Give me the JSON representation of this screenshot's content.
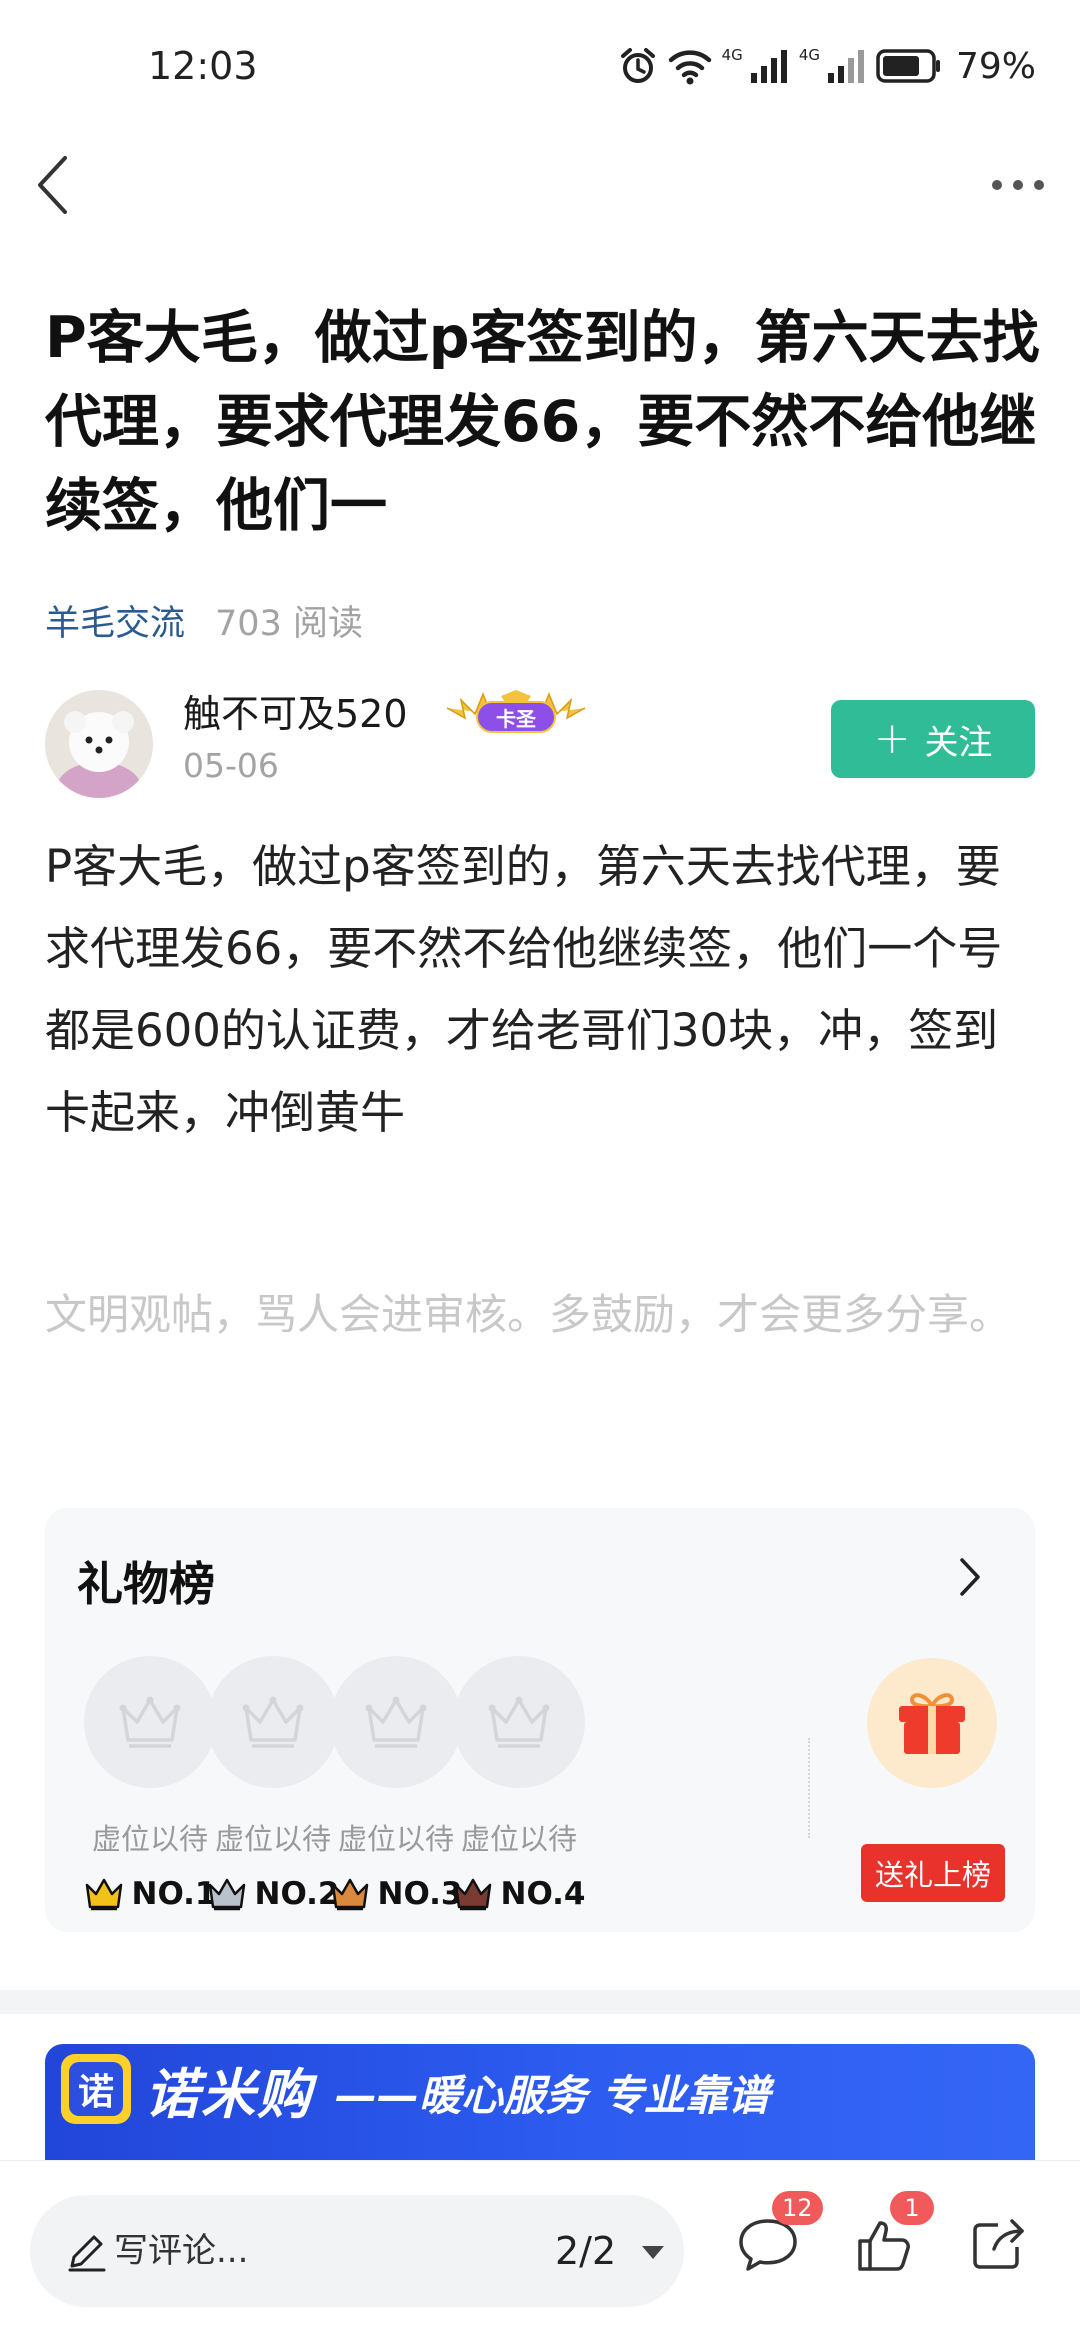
{
  "status_bar": {
    "time": "12:03",
    "network_1": "4G",
    "network_2": "4G",
    "battery": "79%",
    "battery_level": 0.79
  },
  "post": {
    "title": "P客大毛，做过p客签到的，第六天去找代理，要求代理发66，要不然不给他继续签，他们一",
    "category": "羊毛交流",
    "read_count": "703 阅读",
    "body": "P客大毛，做过p客签到的，第六天去找代理，要求代理发66，要不然不给他继续签，他们一个号都是600的认证费，才给老哥们30块，冲，签到卡起来，冲倒黄牛",
    "hint": "文明观帖，骂人会进审核。多鼓励，才会更多分享。"
  },
  "author": {
    "name": "触不可及520",
    "date": "05-06",
    "badge": "卡圣",
    "follow_label": "关注"
  },
  "gift_board": {
    "title": "礼物榜",
    "slots": [
      {
        "label": "虚位以待",
        "rank": "NO.1",
        "crown_color": "#f2c21b"
      },
      {
        "label": "虚位以待",
        "rank": "NO.2",
        "crown_color": "#b9c2cc"
      },
      {
        "label": "虚位以待",
        "rank": "NO.3",
        "crown_color": "#d98a3c"
      },
      {
        "label": "虚位以待",
        "rank": "NO.4",
        "crown_color": "#7a3b32"
      }
    ],
    "send_label": "送礼上榜"
  },
  "banner": {
    "logo_char": "诺",
    "brand": "诺米购",
    "slogan": "——暖心服务 专业靠谱"
  },
  "bottom_bar": {
    "comment_placeholder": "写评论...",
    "page_indicator": "2/2",
    "comment_count": "12",
    "like_count": "1"
  },
  "colors": {
    "accent_green": "#2fbc96",
    "link_blue": "#2b5a8f",
    "badge_red": "#f05a5a",
    "gift_button_red": "#e8322b"
  }
}
